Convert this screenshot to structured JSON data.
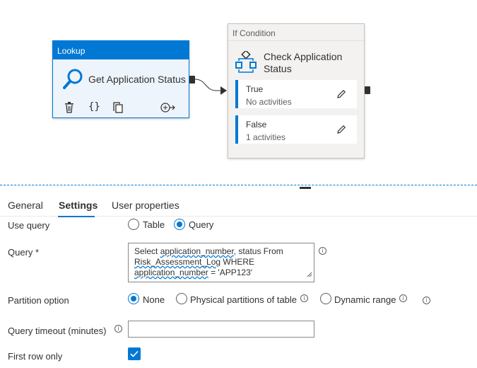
{
  "pipeline": {
    "lookup": {
      "type_label": "Lookup",
      "name": "Get Application Status"
    },
    "if_condition": {
      "type_label": "If Condition",
      "name": "Check Application Status",
      "branches": [
        {
          "label": "True",
          "summary": "No activities"
        },
        {
          "label": "False",
          "summary": "1 activities"
        }
      ]
    }
  },
  "tabs": [
    {
      "label": "General"
    },
    {
      "label": "Settings"
    },
    {
      "label": "User properties"
    }
  ],
  "settings": {
    "use_query": {
      "label": "Use query",
      "options": [
        "Table",
        "Query"
      ],
      "selected": "Query"
    },
    "query": {
      "label": "Query",
      "required_mark": "*",
      "lines": {
        "l1_pre": "Select ",
        "l1_u": "application_number",
        "l1_post": ", status From",
        "l2_u": "Risk_Assessment_Log",
        "l2_post": " WHERE",
        "l3_u": "application_number",
        "l3_post": " = 'APP123'"
      }
    },
    "partition_option": {
      "label": "Partition option",
      "options": [
        "None",
        "Physical partitions of table",
        "Dynamic range"
      ],
      "selected": "None"
    },
    "query_timeout": {
      "label": "Query timeout (minutes)",
      "value": ""
    },
    "first_row_only": {
      "label": "First row only",
      "checked": true
    }
  },
  "colors": {
    "accent": "#0078d4",
    "text": "#323130",
    "muted": "#605e5c"
  }
}
